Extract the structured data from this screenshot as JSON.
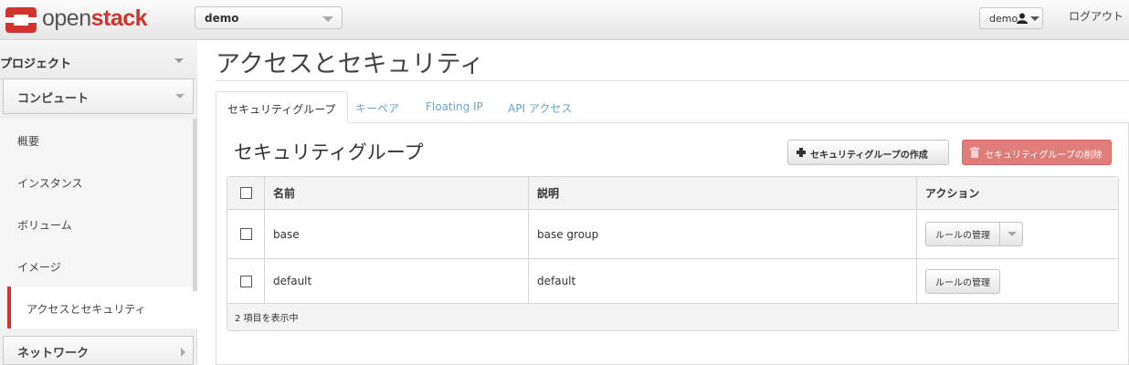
{
  "brand": {
    "open": "open",
    "stack": "stack"
  },
  "header": {
    "project": "demo",
    "user": "demo",
    "logout": "ログアウト"
  },
  "sidebar": {
    "dashboard": "プロジェクト",
    "panel_group": "コンピュート",
    "items": [
      {
        "label": "概要"
      },
      {
        "label": "インスタンス"
      },
      {
        "label": "ボリューム"
      },
      {
        "label": "イメージ"
      },
      {
        "label": "アクセスとセキュリティ"
      }
    ],
    "network": "ネットワーク"
  },
  "page": {
    "title": "アクセスとセキュリティ"
  },
  "tabs": [
    {
      "label": "セキュリティグループ"
    },
    {
      "label": "キーペア"
    },
    {
      "label": "Floating IP"
    },
    {
      "label": "API アクセス"
    }
  ],
  "section": {
    "title": "セキュリティグループ",
    "create_label": "セキュリティグループの作成",
    "delete_label": "セキュリティグループの削除"
  },
  "table": {
    "columns": [
      "名前",
      "説明",
      "アクション"
    ],
    "rows": [
      {
        "name": "base",
        "description": "base group",
        "action": "ルールの管理"
      },
      {
        "name": "default",
        "description": "default",
        "action": "ルールの管理"
      }
    ],
    "footer": "2 項目を表示中"
  },
  "colors": {
    "accent": "#d0342c",
    "link": "#6aa6c5",
    "danger": "#df7d78"
  }
}
